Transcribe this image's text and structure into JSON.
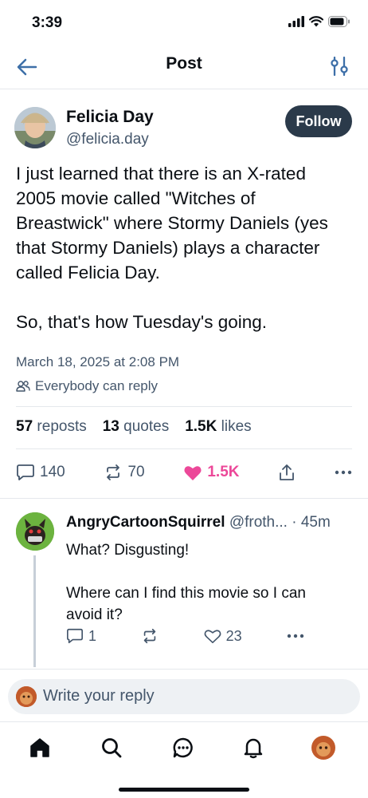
{
  "status_bar": {
    "time": "3:39"
  },
  "header": {
    "title": "Post"
  },
  "post": {
    "author_name": "Felicia Day",
    "author_handle": "@felicia.day",
    "follow_label": "Follow",
    "paragraphs": [
      "I just learned that there is an X-rated 2005 movie called \"Witches of Breastwick\" where Stormy Daniels (yes that Stormy Daniels) plays a character called Felicia Day.",
      "So, that's how Tuesday's going."
    ],
    "date": "March 18, 2025 at 2:08 PM",
    "reply_permission": "Everybody can reply",
    "stats": {
      "reposts_count": "57",
      "reposts_label": "reposts",
      "quotes_count": "13",
      "quotes_label": "quotes",
      "likes_count": "1.5K",
      "likes_label": "likes"
    },
    "actions": {
      "replies": "140",
      "reposts": "70",
      "likes": "1.5K"
    }
  },
  "reply": {
    "author_name": "AngryCartoonSquirrel",
    "author_handle": "@froth...",
    "time": "· 45m",
    "paragraphs": [
      "What? Disgusting!",
      "Where can I find this movie so I can avoid it?"
    ],
    "actions": {
      "replies": "1",
      "reposts": "",
      "likes": "23"
    }
  },
  "compose": {
    "placeholder": "Write your reply"
  },
  "colors": {
    "accent_like": "#ec4899",
    "follow_bg": "#2b3a4a",
    "muted_text": "#44566b"
  },
  "icons": [
    "back-arrow-icon",
    "tune-icon",
    "people-icon",
    "comment-icon",
    "repost-icon",
    "heart-icon",
    "share-icon",
    "more-icon",
    "home-icon",
    "search-icon",
    "chat-icon",
    "bell-icon"
  ]
}
